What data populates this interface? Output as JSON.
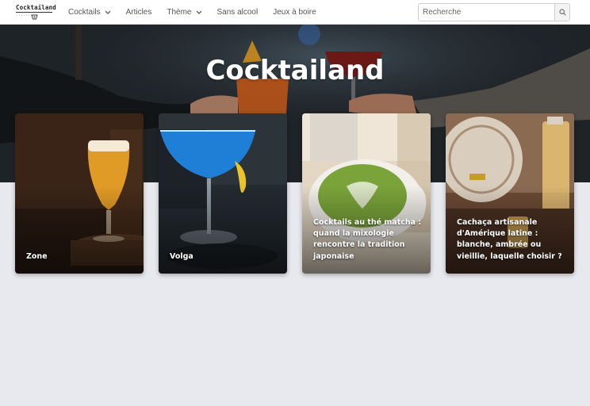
{
  "logo": {
    "text": "Cocktailand",
    "dots": "·········"
  },
  "nav": {
    "items": [
      {
        "label": "Cocktails",
        "dropdown": true
      },
      {
        "label": "Articles",
        "dropdown": false
      },
      {
        "label": "Thème",
        "dropdown": true
      },
      {
        "label": "Sans alcool",
        "dropdown": false
      },
      {
        "label": "Jeux à boire",
        "dropdown": false
      }
    ]
  },
  "search": {
    "placeholder": "Recherche",
    "value": ""
  },
  "hero": {
    "title": "Cocktailand"
  },
  "cards": [
    {
      "title": "Zone"
    },
    {
      "title": "Volga"
    },
    {
      "title": "Cocktails au thé matcha : quand la mixologie rencontre la tradition japonaise"
    },
    {
      "title": "Cachaça artisanale d'Amérique latine : blanche, ambrée ou vieillie, laquelle choisir ?"
    }
  ],
  "colors": {
    "page_bg": "#e8e9ee",
    "nav_text": "#555555",
    "hero_title": "#ffffff"
  }
}
